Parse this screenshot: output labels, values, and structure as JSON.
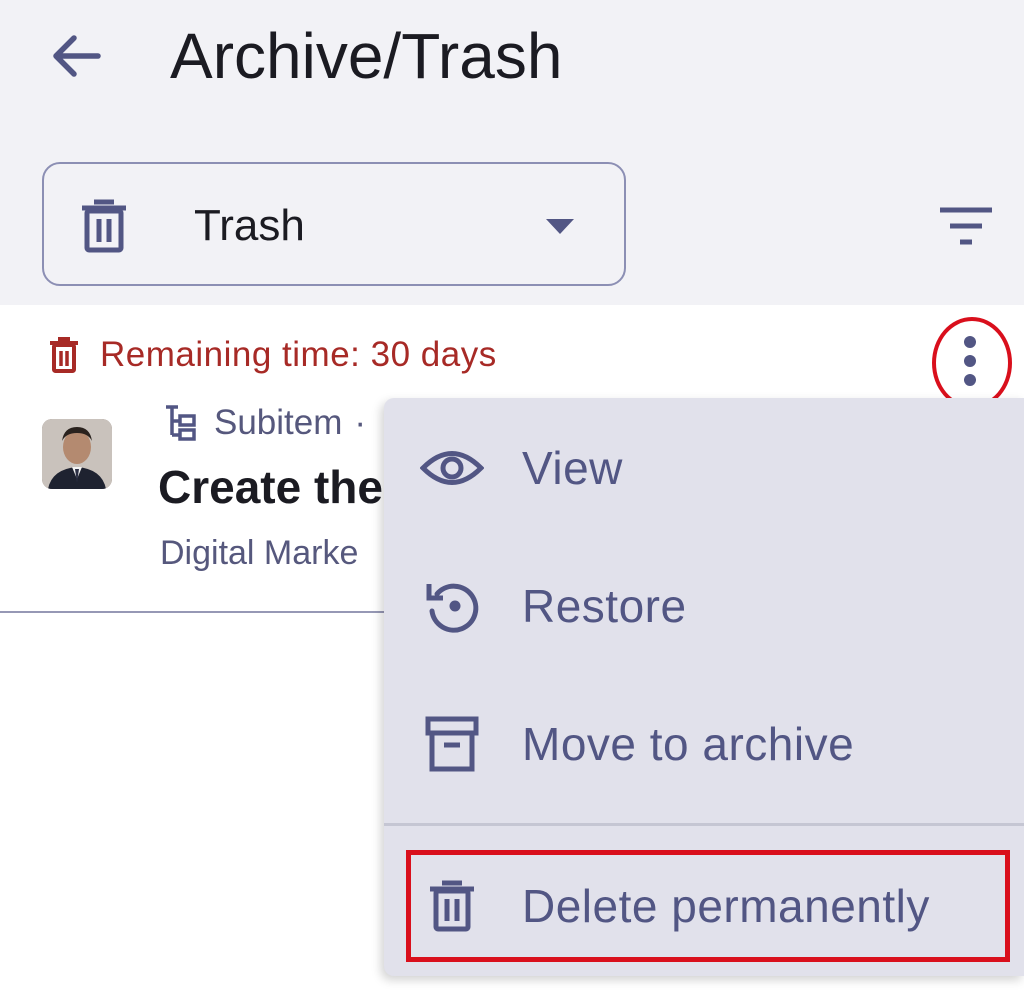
{
  "header": {
    "back_icon": "arrow-left-icon",
    "title": "Archive/Trash"
  },
  "view_select": {
    "icon": "trash-icon",
    "value": "Trash",
    "caret_icon": "caret-down-icon"
  },
  "filter_icon": "filter-icon",
  "item": {
    "remaining_text": "Remaining time: 30 days",
    "subitem_label": "Subitem",
    "subitem_separator": "·",
    "title": "Create the",
    "board": "Digital Marke",
    "more_icon": "more-vertical-icon"
  },
  "menu": {
    "items": [
      {
        "label": "View",
        "icon": "eye-icon"
      },
      {
        "label": "Restore",
        "icon": "restore-icon"
      },
      {
        "label": "Move to archive",
        "icon": "archive-icon"
      },
      {
        "label": "Delete permanently",
        "icon": "trash-icon"
      }
    ]
  },
  "colors": {
    "header_bg": "#f2f2f6",
    "menu_bg": "#e1e1eb",
    "accent": "#525684",
    "warning_text": "#a72a26",
    "highlight": "#d90f1c"
  }
}
